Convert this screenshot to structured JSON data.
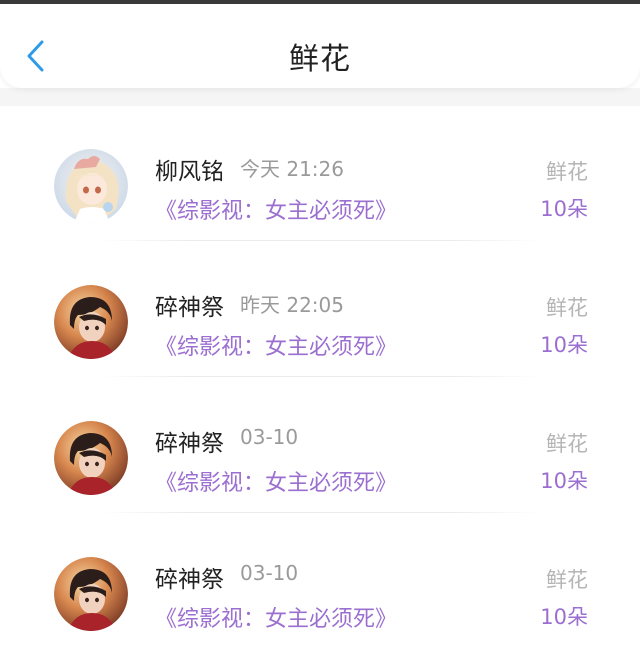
{
  "header": {
    "title": "鲜花",
    "back_icon": "chevron-left-icon",
    "accent_color": "#2f9be8"
  },
  "accent_purple": "#9b6fd0",
  "items": [
    {
      "user": "柳风铭",
      "time": "今天 21:26",
      "book": "《综影视：女主必须死》",
      "gift_label": "鲜花",
      "gift_count": "10朵",
      "avatar": "anime-girl-avatar"
    },
    {
      "user": "碎神祭",
      "time": "昨天 22:05",
      "book": "《综影视：女主必须死》",
      "gift_label": "鲜花",
      "gift_count": "10朵",
      "avatar": "anime-boy-avatar"
    },
    {
      "user": "碎神祭",
      "time": "03-10",
      "book": "《综影视：女主必须死》",
      "gift_label": "鲜花",
      "gift_count": "10朵",
      "avatar": "anime-boy-avatar"
    },
    {
      "user": "碎神祭",
      "time": "03-10",
      "book": "《综影视：女主必须死》",
      "gift_label": "鲜花",
      "gift_count": "10朵",
      "avatar": "anime-boy-avatar"
    }
  ]
}
